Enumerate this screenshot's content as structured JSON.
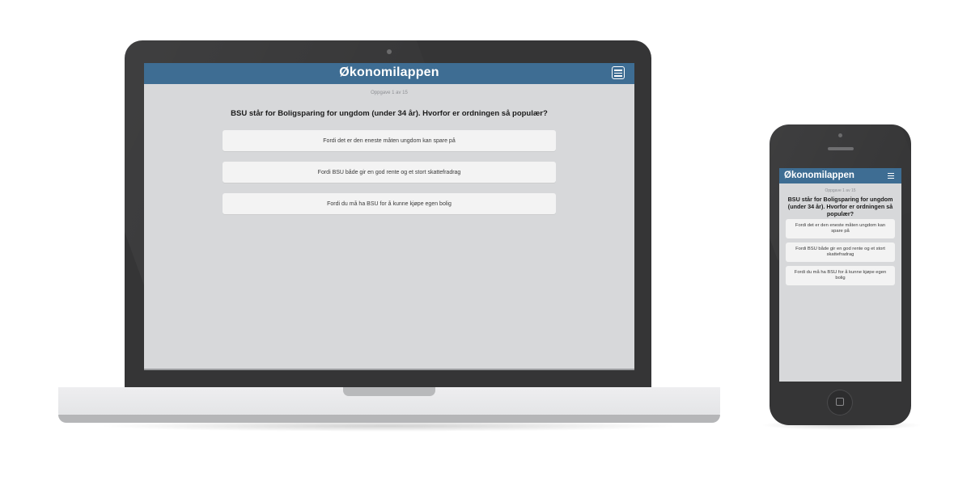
{
  "app": {
    "title": "Økonomilappen",
    "menu_icon": "hamburger-menu-icon"
  },
  "quiz": {
    "progress": "Oppgave 1 av 15",
    "question": "BSU står for Boligsparing for ungdom (under 34 år). Hvorfor er ordningen så populær?",
    "answers": [
      {
        "label": "Fordi det er den eneste måten ungdom kan spare på"
      },
      {
        "label": "Fordi BSU både gir en god rente og et stort skattefradrag"
      },
      {
        "label": "Fordi du må ha BSU for å kunne kjøpe egen bolig"
      }
    ]
  },
  "colors": {
    "header": "#3e6d93",
    "screen_background": "#d7d8da",
    "answer_background": "#f3f3f3",
    "device_frame": "#353536"
  }
}
